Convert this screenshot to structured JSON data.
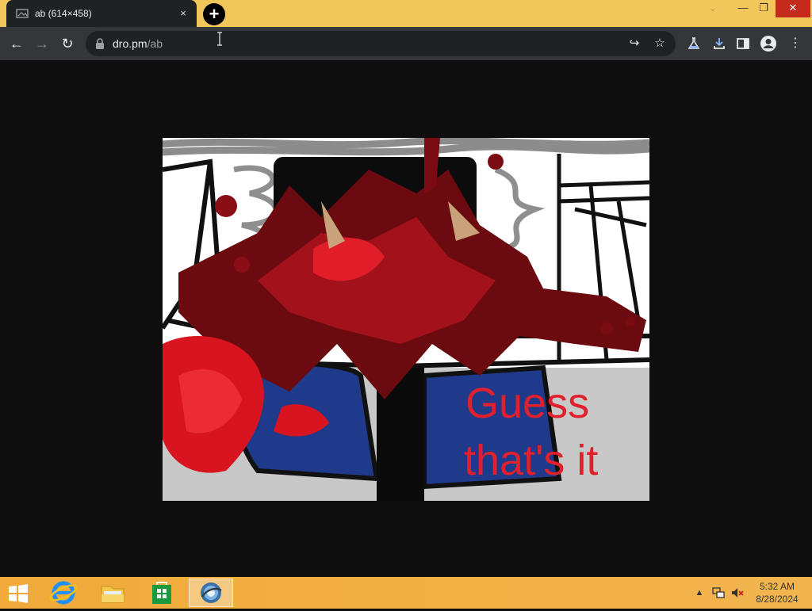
{
  "window": {
    "tab_title": "ab (614×458)",
    "tab_close": "×",
    "new_tab": "+",
    "controls": {
      "chevron": "⌄",
      "minimize": "—",
      "maximize": "❐",
      "close": "✕"
    }
  },
  "toolbar": {
    "back": "←",
    "forward": "→",
    "reload": "↻",
    "url_host": "dro.pm",
    "url_path": "/ab",
    "share": "↪",
    "bookmark": "☆",
    "menu": "⋮"
  },
  "content": {
    "image_caption_line1": "Guess",
    "image_caption_line2": "that's it"
  },
  "taskbar": {
    "clock_time": "5:32 AM",
    "clock_date": "8/28/2024",
    "tray_up": "▲"
  },
  "colors": {
    "titlebar": "#f1c65b",
    "toolbar": "#35363a",
    "caption_red": "#e0202d",
    "taskbar": "#f2ad40"
  }
}
